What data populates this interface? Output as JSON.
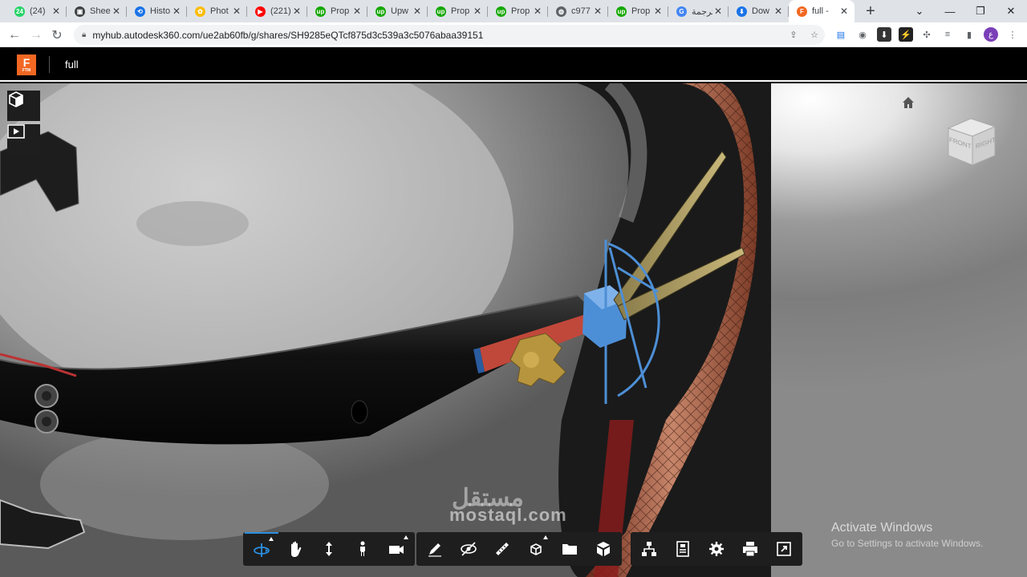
{
  "browser": {
    "tabs": [
      {
        "label": "(24)",
        "favicon": "whatsapp-icon",
        "color": "#25d366",
        "glyph": "24"
      },
      {
        "label": "Shee",
        "favicon": "sheets-icon",
        "color": "#3c4043",
        "glyph": "▣"
      },
      {
        "label": "Histo",
        "favicon": "history-icon",
        "color": "#1a73e8",
        "glyph": "⟲"
      },
      {
        "label": "Phot",
        "favicon": "photos-icon",
        "color": "#fbbc04",
        "glyph": "✿"
      },
      {
        "label": "(221)",
        "favicon": "youtube-icon",
        "color": "#ff0000",
        "glyph": "▶"
      },
      {
        "label": "Prop",
        "favicon": "upwork-icon",
        "color": "#14a800",
        "glyph": "up"
      },
      {
        "label": "Upw",
        "favicon": "upwork-icon",
        "color": "#14a800",
        "glyph": "up"
      },
      {
        "label": "Prop",
        "favicon": "upwork-icon",
        "color": "#14a800",
        "glyph": "up"
      },
      {
        "label": "Prop",
        "favicon": "upwork-icon",
        "color": "#14a800",
        "glyph": "up"
      },
      {
        "label": "c977",
        "favicon": "globe-icon",
        "color": "#5f6368",
        "glyph": "◍"
      },
      {
        "label": "Prop",
        "favicon": "upwork-icon",
        "color": "#14a800",
        "glyph": "up"
      },
      {
        "label": "ترجمة",
        "favicon": "translate-icon",
        "color": "#4285f4",
        "glyph": "G"
      },
      {
        "label": "Dow",
        "favicon": "download-icon",
        "color": "#1a73e8",
        "glyph": "⬇"
      },
      {
        "label": "full -",
        "favicon": "fusion-icon",
        "color": "#f26722",
        "glyph": "F",
        "active": true
      }
    ],
    "new_tab": "+",
    "address": {
      "url": "myhub.autodesk360.com/ue2ab60fb/g/shares/SH9285eQTcf875d3c539a3c5076abaa39151"
    },
    "profile_initial": "ع",
    "profile_color": "#7b3fb8"
  },
  "app": {
    "logo_letter": "F",
    "logo_sub": "FTM",
    "title": "full"
  },
  "viewer": {
    "viewcube": {
      "front": "FRONT",
      "right": "RIGHT"
    },
    "activate_windows": {
      "title": "Activate Windows",
      "subtitle": "Go to Settings to activate Windows."
    },
    "watermark": {
      "arabic": "مستقل",
      "latin": "mostaql.com"
    }
  },
  "toolbar": {
    "navigation": [
      "orbit-icon",
      "pan-icon",
      "zoom-icon",
      "first-person-icon",
      "camera-icon"
    ],
    "tools": [
      "markup-icon",
      "section-icon",
      "measure-icon",
      "explode-icon",
      "folder-icon",
      "model-cube-icon"
    ],
    "settings": [
      "model-browser-icon",
      "properties-icon",
      "settings-icon",
      "print-icon",
      "fullscreen-icon"
    ],
    "accent": "#2b8fe0"
  }
}
